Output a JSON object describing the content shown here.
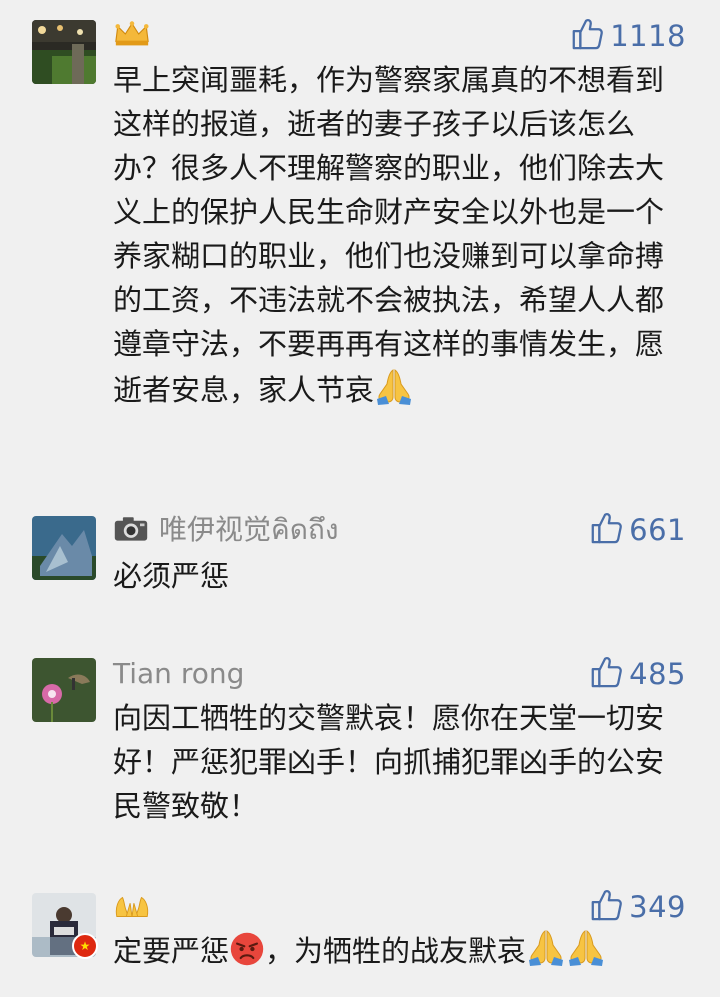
{
  "comments": [
    {
      "name": "",
      "badge_icon": "crown-icon",
      "likes": "1118",
      "text_main": "早上突闻噩耗，作为警察家属真的不想看到这样的报道，逝者的妻子孩子以后该怎么办？很多人不理解警察的职业，他们除去大义上的保护人民生命财产安全以外也是一个养家糊口的职业，他们也没赚到可以拿命搏的工资，不违法就不会被执法，希望人人都遵章守法，不要再再有这样的事情发生，愿逝者安息，家人节哀",
      "emoji": "praying-hands-icon"
    },
    {
      "name": "唯伊视觉คิดถึง",
      "badge_icon": "camera-icon",
      "likes": "661",
      "text_main": "必须严惩"
    },
    {
      "name": "Tian rong",
      "likes": "485",
      "text_main": "向因工牺牲的交警默哀！愿你在天堂一切安好！严惩犯罪凶手！向抓捕犯罪凶手的公安民警致敬！"
    },
    {
      "name": "",
      "badge_icon": "raised-hands-icon",
      "likes": "349",
      "text_part1": "定要严惩",
      "text_part2": "，为牺牲的战友默哀",
      "emojis": [
        "angry-face-icon",
        "praying-hands-icon",
        "praying-hands-icon"
      ]
    }
  ],
  "colors": {
    "background": "#f0f0f0",
    "like_blue": "#4a6ea8",
    "name_gray": "#8a8a8a",
    "text": "#1a1a1a"
  }
}
